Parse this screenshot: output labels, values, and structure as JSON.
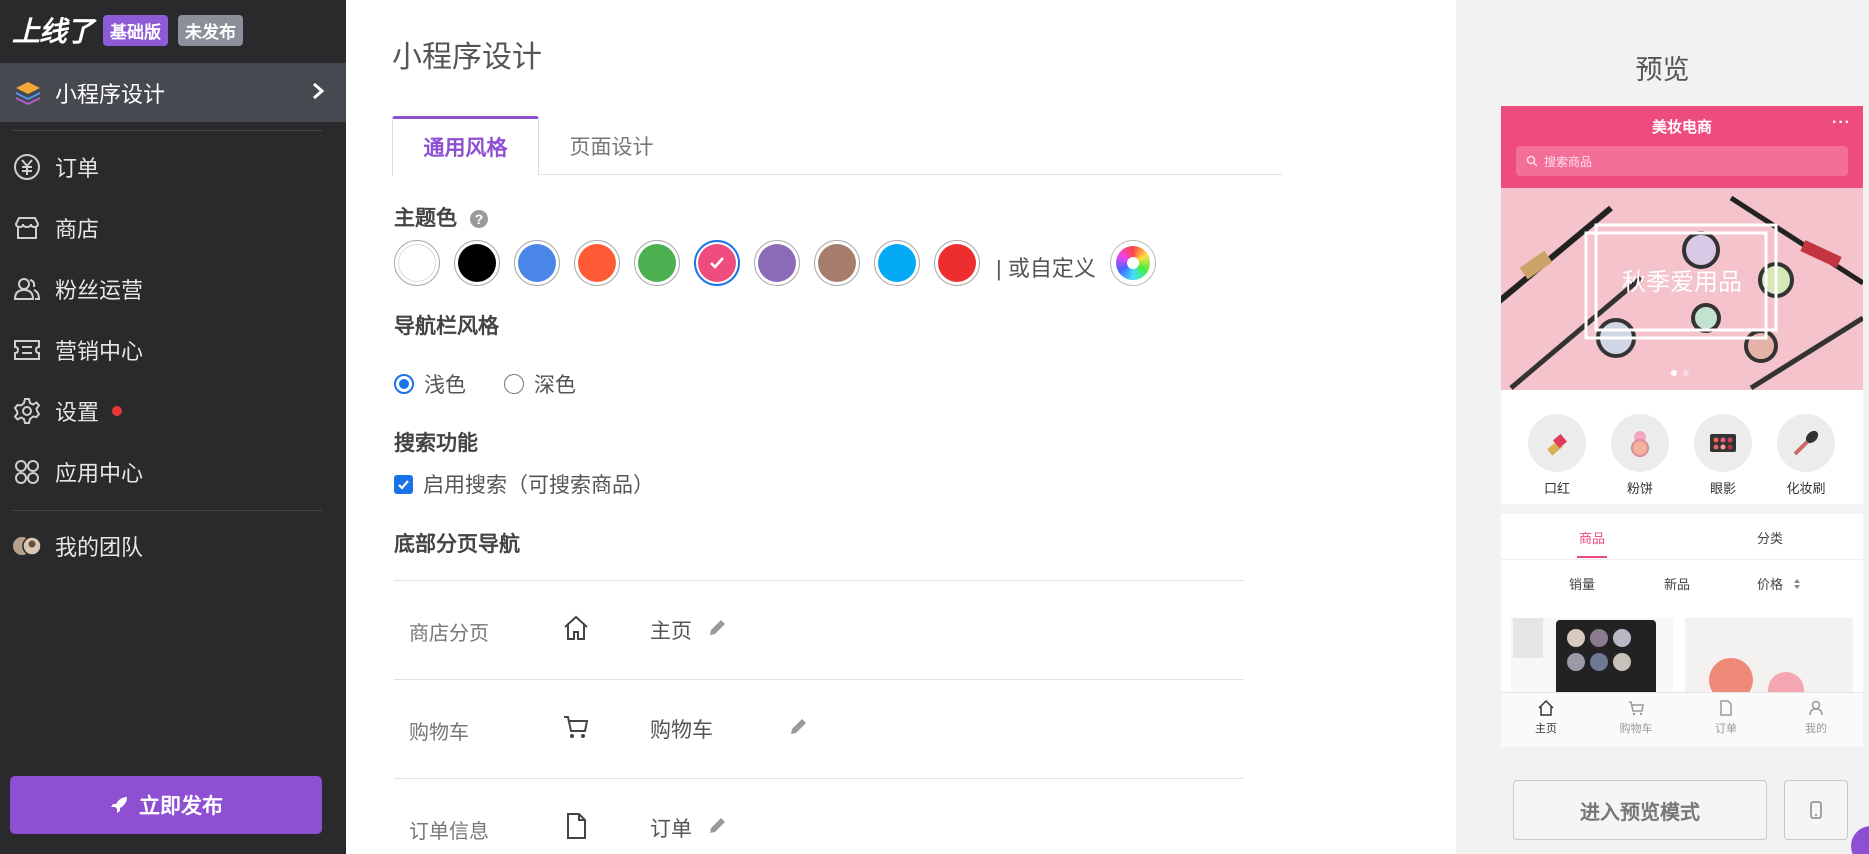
{
  "sidebar": {
    "brand": {
      "logo": "上线了",
      "plan_badge": "基础版",
      "status_badge": "未发布"
    },
    "active_item": {
      "label": "小程序设计",
      "icon": "layers-icon"
    },
    "items": [
      {
        "label": "订单",
        "icon": "yen-circle-icon"
      },
      {
        "label": "商店",
        "icon": "store-icon"
      },
      {
        "label": "粉丝运营",
        "icon": "users-icon"
      },
      {
        "label": "营销中心",
        "icon": "ticket-icon"
      },
      {
        "label": "设置",
        "icon": "gear-icon"
      },
      {
        "label": "应用中心",
        "icon": "apps-grid-icon"
      }
    ],
    "team": {
      "label": "我的团队",
      "icon": "team-avatar-icon"
    },
    "publish_button": "立即发布"
  },
  "main": {
    "title": "小程序设计",
    "tabs": [
      {
        "label": "通用风格",
        "active": true
      },
      {
        "label": "页面设计",
        "active": false
      }
    ],
    "theme_color": {
      "label": "主题色",
      "swatches": [
        "#ffffff",
        "#000000",
        "#4a86e8",
        "#ff5a36",
        "#4caf50",
        "#ee4b7e",
        "#8b6bb8",
        "#a67c6a",
        "#03a9f4",
        "#ee2e2e"
      ],
      "selected": "#ee4b7e",
      "custom_label": "| 或自定义"
    },
    "navbar_style": {
      "label": "导航栏风格",
      "options": [
        "浅色",
        "深色"
      ],
      "selected": "浅色"
    },
    "search": {
      "label": "搜索功能",
      "checkbox_label": "启用搜索（可搜索商品）",
      "checked": true
    },
    "bottom_nav": {
      "label": "底部分页导航",
      "rows": [
        {
          "name": "商店分页",
          "icon": "home-icon",
          "label": "主页"
        },
        {
          "name": "购物车",
          "icon": "cart-icon",
          "label": "购物车"
        },
        {
          "name": "订单信息",
          "icon": "document-icon",
          "label": "订单"
        }
      ]
    }
  },
  "preview": {
    "title": "预览",
    "phone": {
      "store_name": "美妆电商",
      "menu_dots": "···",
      "search_placeholder": "搜索商品",
      "banner_text": "秋季爱用品",
      "categories": [
        "口红",
        "粉饼",
        "眼影",
        "化妆刷"
      ],
      "product_tabs": [
        "商品",
        "分类"
      ],
      "sort_options": [
        "销量",
        "新品",
        "价格"
      ],
      "tabbar": [
        "主页",
        "购物车",
        "订单",
        "我的"
      ]
    },
    "enter_preview_button": "进入预览模式"
  }
}
